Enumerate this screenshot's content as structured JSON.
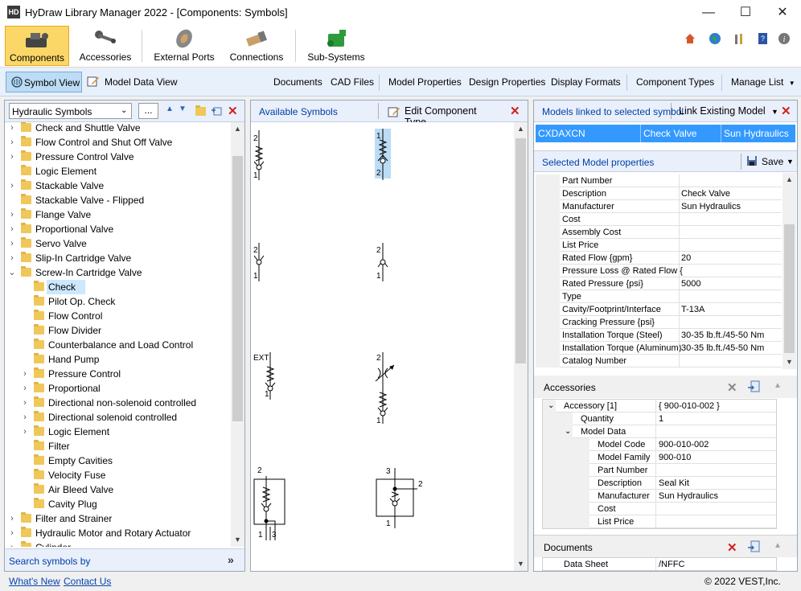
{
  "window": {
    "title": "HyDraw Library Manager 2022 - [Components: Symbols]",
    "app_icon": "HD",
    "min": "—",
    "max": "☐",
    "close": "✕"
  },
  "ribbon": {
    "items": [
      {
        "label": "Components",
        "icon": "components-icon"
      },
      {
        "label": "Accessories",
        "icon": "accessories-icon"
      },
      {
        "label": "External Ports",
        "icon": "external-ports-icon"
      },
      {
        "label": "Connections",
        "icon": "connections-icon"
      },
      {
        "label": "Sub-Systems",
        "icon": "sub-systems-icon"
      }
    ],
    "right_icons": [
      "home-icon",
      "globe-icon",
      "tools-icon",
      "help-book-icon",
      "info-icon"
    ]
  },
  "toolbar2": {
    "symbol_view": "Symbol View",
    "model_data_view": "Model Data View",
    "documents": "Documents",
    "cad_files": "CAD Files",
    "model_properties": "Model Properties",
    "design_properties": "Design Properties",
    "display_formats": "Display Formats",
    "component_types": "Component Types",
    "manage_list": "Manage List"
  },
  "left": {
    "dropdown": "Hydraulic Symbols",
    "ellipsis": "...",
    "tree": [
      {
        "label": "Check and Shuttle Valve",
        "level": 0,
        "exp": ">"
      },
      {
        "label": "Flow Control and Shut Off Valve",
        "level": 0,
        "exp": ">"
      },
      {
        "label": "Pressure Control Valve",
        "level": 0,
        "exp": ">"
      },
      {
        "label": "Logic Element",
        "level": 0,
        "exp": ""
      },
      {
        "label": "Stackable Valve",
        "level": 0,
        "exp": ">"
      },
      {
        "label": "Stackable Valve - Flipped",
        "level": 0,
        "exp": ""
      },
      {
        "label": "Flange Valve",
        "level": 0,
        "exp": ">"
      },
      {
        "label": "Proportional Valve",
        "level": 0,
        "exp": ">"
      },
      {
        "label": "Servo Valve",
        "level": 0,
        "exp": ">"
      },
      {
        "label": "Slip-In Cartridge Valve",
        "level": 0,
        "exp": ">"
      },
      {
        "label": "Screw-In Cartridge Valve",
        "level": 0,
        "exp": "v"
      },
      {
        "label": "Check",
        "level": 1,
        "exp": "",
        "selected": true
      },
      {
        "label": "Pilot Op. Check",
        "level": 1,
        "exp": ""
      },
      {
        "label": "Flow Control",
        "level": 1,
        "exp": ""
      },
      {
        "label": "Flow Divider",
        "level": 1,
        "exp": ""
      },
      {
        "label": "Counterbalance and Load Control",
        "level": 1,
        "exp": ""
      },
      {
        "label": "Hand Pump",
        "level": 1,
        "exp": ""
      },
      {
        "label": "Pressure Control",
        "level": 1,
        "exp": ">"
      },
      {
        "label": "Proportional",
        "level": 1,
        "exp": ">"
      },
      {
        "label": "Directional non-solenoid controlled",
        "level": 1,
        "exp": ">"
      },
      {
        "label": "Directional solenoid controlled",
        "level": 1,
        "exp": ">"
      },
      {
        "label": "Logic Element",
        "level": 1,
        "exp": ">"
      },
      {
        "label": "Filter",
        "level": 1,
        "exp": ""
      },
      {
        "label": "Empty Cavities",
        "level": 1,
        "exp": ""
      },
      {
        "label": "Velocity Fuse",
        "level": 1,
        "exp": ""
      },
      {
        "label": "Air Bleed Valve",
        "level": 1,
        "exp": ""
      },
      {
        "label": "Cavity Plug",
        "level": 1,
        "exp": ""
      },
      {
        "label": "Filter and Strainer",
        "level": 0,
        "exp": ">"
      },
      {
        "label": "Hydraulic Motor and Rotary Actuator",
        "level": 0,
        "exp": ">"
      },
      {
        "label": "Cylinder",
        "level": 0,
        "exp": ">"
      }
    ],
    "search": "Search symbols by"
  },
  "middle": {
    "available": "Available Symbols",
    "edit_type": "Edit Component Type",
    "symbol_labels": {
      "s1_top": "2",
      "s1_bot": "1",
      "s2_top": "1",
      "s2_bot": "2",
      "s3_top": "2",
      "s3_bot": "1",
      "s4_top": "2",
      "s4_bot": "1",
      "s5_top": "EXT",
      "s5_bot": "1",
      "s6_top": "2",
      "s6_bot": "1",
      "s7_top": "2",
      "s7_b1": "1",
      "s7_b2": "3",
      "s8_top": "3",
      "s8_right": "2",
      "s8_bot": "1"
    }
  },
  "right": {
    "linked_title": "Models linked to selected symbol",
    "link_existing": "Link Existing Model",
    "model_row": {
      "code": "CXDAXCN",
      "type": "Check Valve",
      "maker": "Sun Hydraulics"
    },
    "selected_props_title": "Selected Model properties",
    "save": "Save",
    "properties": [
      {
        "k": "Part Number",
        "v": ""
      },
      {
        "k": "Description",
        "v": "Check Valve"
      },
      {
        "k": "Manufacturer",
        "v": "Sun Hydraulics"
      },
      {
        "k": "Cost",
        "v": ""
      },
      {
        "k": "Assembly Cost",
        "v": ""
      },
      {
        "k": "List Price",
        "v": ""
      },
      {
        "k": "Rated Flow {gpm}",
        "v": "20"
      },
      {
        "k": "Pressure Loss @ Rated Flow {",
        "v": ""
      },
      {
        "k": "Rated Pressure {psi}",
        "v": "5000"
      },
      {
        "k": "Type",
        "v": ""
      },
      {
        "k": "Cavity/Footprint/Interface",
        "v": "T-13A"
      },
      {
        "k": "Cracking Pressure {psi}",
        "v": ""
      },
      {
        "k": "Installation Torque (Steel)",
        "v": "30-35 lb.ft./45-50 Nm"
      },
      {
        "k": "Installation Torque (Aluminum)",
        "v": "30-35 lb.ft./45-50 Nm"
      },
      {
        "k": "Catalog Number",
        "v": ""
      }
    ],
    "accessories_title": "Accessories",
    "accessories": [
      {
        "k": "Accessory [1]",
        "v": "{ 900-010-002 }",
        "indent": 0,
        "exp": "v"
      },
      {
        "k": "Quantity",
        "v": "1",
        "indent": 1,
        "exp": ""
      },
      {
        "k": "Model Data",
        "v": "",
        "indent": 1,
        "exp": "v"
      },
      {
        "k": "Model Code",
        "v": "900-010-002",
        "indent": 2,
        "exp": ""
      },
      {
        "k": "Model Family",
        "v": "900-010",
        "indent": 2,
        "exp": ""
      },
      {
        "k": "Part Number",
        "v": "",
        "indent": 2,
        "exp": ""
      },
      {
        "k": "Description",
        "v": "Seal Kit",
        "indent": 2,
        "exp": ""
      },
      {
        "k": "Manufacturer",
        "v": "Sun Hydraulics",
        "indent": 2,
        "exp": ""
      },
      {
        "k": "Cost",
        "v": "",
        "indent": 2,
        "exp": ""
      },
      {
        "k": "List Price",
        "v": "",
        "indent": 2,
        "exp": ""
      }
    ],
    "documents_title": "Documents",
    "documents": [
      {
        "k": "Data Sheet",
        "v": "/NFFC"
      }
    ]
  },
  "status": {
    "whats_new": "What's New",
    "contact": "Contact Us",
    "copyright": "© 2022 VEST,Inc."
  },
  "colors": {
    "accent": "#0078d7",
    "selected_row": "#3399ff",
    "ribbon_active": "#f5c542"
  }
}
